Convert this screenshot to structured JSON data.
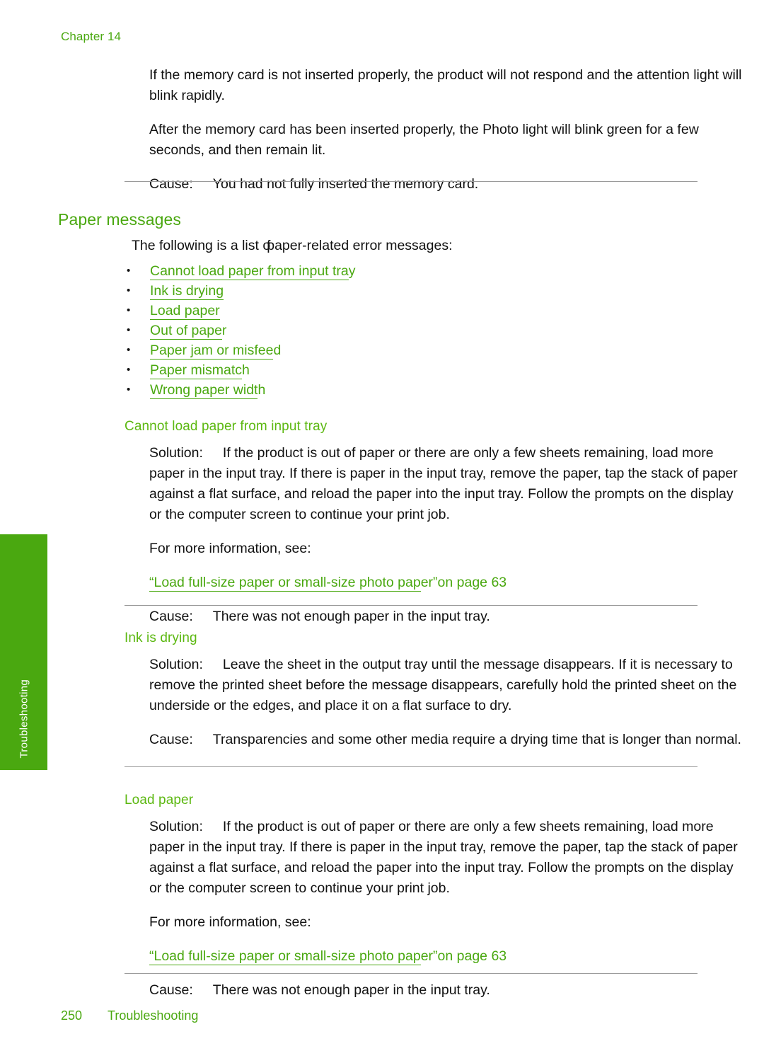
{
  "running_head": "Chapter 14",
  "side_tab": {
    "label": "Troubleshooting"
  },
  "colors": {
    "accent_green": "#4aa810",
    "sub_head_green": "#5cb811",
    "rule_gray": "#9a9a9a",
    "body_black": "#111111"
  },
  "intro_block": {
    "paragraph_1": "If the memory card is not inserted properly, the product will not respond and the attention light will blink rapidly.",
    "paragraph_2": "After the memory card has been inserted properly, the Photo light will blink green for a few seconds, and then remain lit.",
    "cause_label": "Cause:",
    "cause_text": "You had not fully inserted the memory card."
  },
  "section": {
    "title": "Paper messages",
    "intro_lead": "The following is a list ",
    "intro_overlap_a": "of",
    "intro_overlap_b": "p",
    "intro_tail": "aper-related error messages:",
    "intro_full": "The following is a list of paper-related error messages:",
    "links": [
      {
        "underlined": "Cannot load paper from input tra",
        "tail": "y"
      },
      {
        "underlined": "Ink is drying",
        "tail": ""
      },
      {
        "underlined": "Load paper",
        "tail": ""
      },
      {
        "underlined": "Out of pape",
        "tail": "r"
      },
      {
        "underlined": "Paper jam or misfee",
        "tail": "d"
      },
      {
        "underlined": "Paper mismatc",
        "tail": "h"
      },
      {
        "underlined": "Wrong paper widt",
        "tail": "h"
      }
    ]
  },
  "subsections": [
    {
      "heading": "Cannot load paper from input tray",
      "solution_label": "Solution:",
      "solution_text": "If the product is out of paper or there are only a few sheets remaining, load more paper in the input tray. If there is paper in the input tray, remove the paper, tap the stack of paper against a flat surface, and reload the paper into the input tray. Follow the prompts on the display or the computer screen to continue your print job.",
      "more_info": "For more information, see:",
      "xref_underlined": "“Load full-size paper or small-size photo pap",
      "xref_tail": "er”on page 63",
      "cause_label": "Cause:",
      "cause_text": "There was not enough paper in the input tray."
    },
    {
      "heading": "Ink is drying",
      "solution_label": "Solution:",
      "solution_text": "Leave the sheet in the output tray until the message disappears. If it is necessary to remove the printed sheet before the message disappears, carefully hold the printed sheet on the underside or the edges, and place it on a flat surface to dry.",
      "cause_label": "Cause:",
      "cause_text": "Transparencies and some other media require a drying time that is longer than normal."
    },
    {
      "heading": "Load paper",
      "solution_label": "Solution:",
      "solution_text": "If the product is out of paper or there are only a few sheets remaining, load more paper in the input tray. If there is paper in the input tray, remove the paper, tap the stack of paper against a flat surface, and reload the paper into the input tray. Follow the prompts on the display or the computer screen to continue your print job.",
      "more_info": "For more information, see:",
      "xref_underlined": "“Load full-size paper or small-size photo pap",
      "xref_tail": "er”on page 63",
      "cause_label": "Cause:",
      "cause_text": "There was not enough paper in the input tray."
    }
  ],
  "footer": {
    "page_number": "250",
    "section_name": "Troubleshooting"
  }
}
